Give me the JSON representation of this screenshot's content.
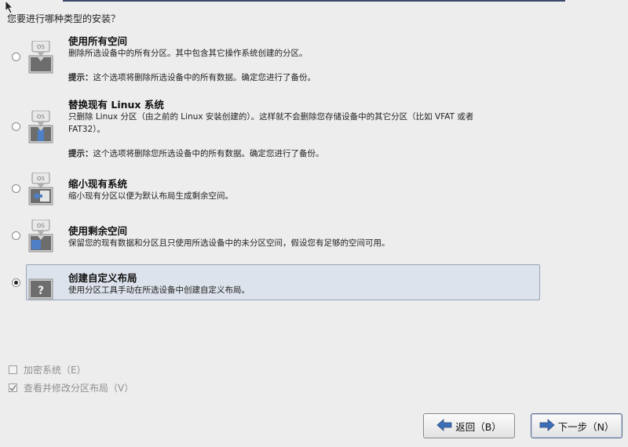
{
  "question": "您要进行哪种类型的安装？",
  "options": [
    {
      "title": "使用所有空间",
      "desc": "删除所选设备中的所有分区。其中包含其它操作系统创建的分区。",
      "hint_label": "提示：",
      "hint_text": "这个选项将删除所选设备中的所有数据。确定您进行了备份。",
      "icon": "disk-os-erase-icon",
      "selected": false
    },
    {
      "title": "替换现有 Linux 系统",
      "desc_line1": "只删除 Linux 分区（由之前的 Linux 安装创建的）。这样就不会删除您存储设备中的其它分区（比如 VFAT 或者",
      "desc_line2": "FAT32）。",
      "hint_label": "提示：",
      "hint_text": "这个选项将删除您所选设备中的所有数据。确定您进行了备份。",
      "icon": "disk-os-replace-icon",
      "selected": false
    },
    {
      "title": "缩小现有系统",
      "desc": "缩小现有分区以便为默认布局生成剩余空间。",
      "icon": "disk-shrink-icon",
      "selected": false
    },
    {
      "title": "使用剩余空间",
      "desc": "保留您的现有数据和分区且只使用所选设备中的未分区空间，假设您有足够的空间可用。",
      "icon": "disk-free-space-icon",
      "selected": false
    },
    {
      "title": "创建自定义布局",
      "desc": "使用分区工具手动在所选设备中创建自定义布局。",
      "icon": "custom-layout-icon",
      "selected": true
    }
  ],
  "checks": {
    "encrypt_label": "加密系统（E）",
    "encrypt_checked": false,
    "review_label": "查看并修改分区布局（V）",
    "review_checked": true
  },
  "buttons": {
    "back_label": "返回（B）",
    "next_label": "下一步（N）"
  },
  "colors": {
    "background": "#ededed",
    "selected_row": "#dde3ec",
    "disk_blue": "#4f7fc6"
  }
}
